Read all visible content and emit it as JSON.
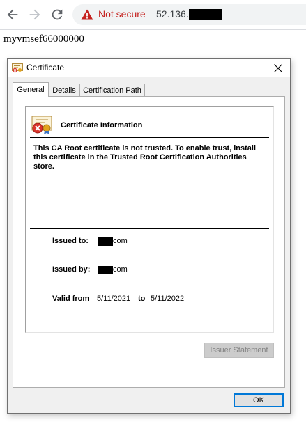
{
  "browser": {
    "security_label": "Not secure",
    "url_visible": "52.136.1"
  },
  "page": {
    "body_text": "myvmsef66000000"
  },
  "dialog": {
    "title": "Certificate",
    "tabs": [
      {
        "label": "General",
        "selected": true
      },
      {
        "label": "Details",
        "selected": false
      },
      {
        "label": "Certification Path",
        "selected": false
      }
    ],
    "heading": "Certificate Information",
    "warning": "This CA Root certificate is not trusted. To enable trust, install this certificate in the Trusted Root Certification Authorities store.",
    "issued_to_label": "Issued to:",
    "issued_to_suffix": "com",
    "issued_by_label": "Issued by:",
    "issued_by_suffix": "com",
    "valid_from_label": "Valid from",
    "valid_from": "5/11/2021",
    "valid_to_label": "to",
    "valid_to": "5/11/2022",
    "issuer_statement_label": "Issuer Statement",
    "ok_label": "OK"
  },
  "colors": {
    "warning_red": "#c5221f",
    "focus_blue": "#0078d7"
  },
  "icons": [
    "back-arrow-icon",
    "forward-arrow-icon",
    "reload-icon",
    "warning-triangle-icon",
    "certificate-icon",
    "close-icon",
    "certificate-error-icon"
  ]
}
